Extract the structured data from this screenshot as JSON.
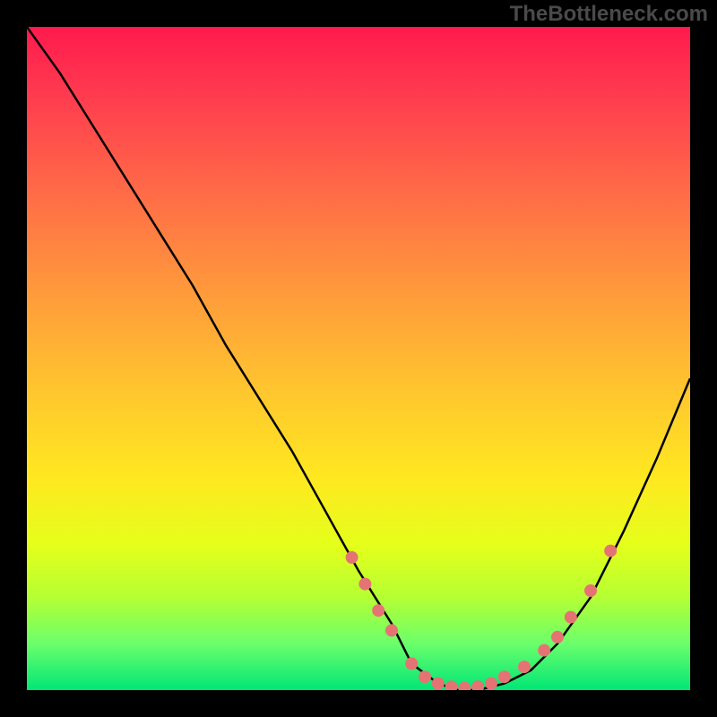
{
  "attribution": "TheBottleneck.com",
  "chart_data": {
    "type": "line",
    "title": "",
    "xlabel": "",
    "ylabel": "",
    "xlim": [
      0,
      100
    ],
    "ylim": [
      0,
      100
    ],
    "grid": false,
    "legend": false,
    "series": [
      {
        "name": "curve",
        "color": "#000000",
        "x": [
          0,
          5,
          10,
          15,
          20,
          25,
          30,
          35,
          40,
          45,
          50,
          55,
          58,
          62,
          65,
          68,
          72,
          76,
          80,
          85,
          90,
          95,
          100
        ],
        "y": [
          100,
          93,
          85,
          77,
          69,
          61,
          52,
          44,
          36,
          27,
          18,
          10,
          4,
          1,
          0,
          0,
          1,
          3,
          7,
          14,
          24,
          35,
          47
        ]
      }
    ],
    "markers": [
      {
        "x": 49,
        "y": 20,
        "color": "#e57373",
        "r": 7
      },
      {
        "x": 51,
        "y": 16,
        "color": "#e57373",
        "r": 7
      },
      {
        "x": 53,
        "y": 12,
        "color": "#e57373",
        "r": 7
      },
      {
        "x": 55,
        "y": 9,
        "color": "#e57373",
        "r": 7
      },
      {
        "x": 58,
        "y": 4,
        "color": "#e57373",
        "r": 7
      },
      {
        "x": 60,
        "y": 2,
        "color": "#e57373",
        "r": 7
      },
      {
        "x": 62,
        "y": 1,
        "color": "#e57373",
        "r": 7
      },
      {
        "x": 64,
        "y": 0.5,
        "color": "#e57373",
        "r": 7
      },
      {
        "x": 66,
        "y": 0.3,
        "color": "#e57373",
        "r": 7
      },
      {
        "x": 68,
        "y": 0.5,
        "color": "#e57373",
        "r": 7
      },
      {
        "x": 70,
        "y": 1,
        "color": "#e57373",
        "r": 7
      },
      {
        "x": 72,
        "y": 2,
        "color": "#e57373",
        "r": 7
      },
      {
        "x": 75,
        "y": 3.5,
        "color": "#e57373",
        "r": 7
      },
      {
        "x": 78,
        "y": 6,
        "color": "#e57373",
        "r": 7
      },
      {
        "x": 80,
        "y": 8,
        "color": "#e57373",
        "r": 7
      },
      {
        "x": 82,
        "y": 11,
        "color": "#e57373",
        "r": 7
      },
      {
        "x": 85,
        "y": 15,
        "color": "#e57373",
        "r": 7
      },
      {
        "x": 88,
        "y": 21,
        "color": "#e57373",
        "r": 7
      }
    ]
  }
}
